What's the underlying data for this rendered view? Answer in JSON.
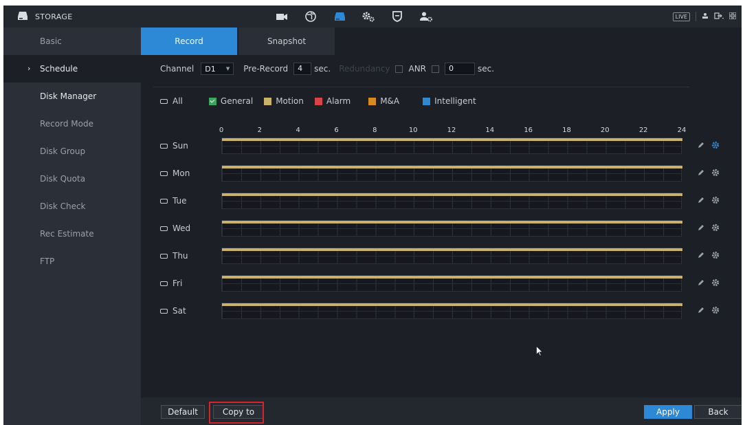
{
  "header": {
    "title": "STORAGE",
    "title_icon": "storage-drive-icon",
    "nav_icons": [
      "camera-icon",
      "network-globe-icon",
      "storage-drive-icon",
      "system-gears-icon",
      "security-shield-icon",
      "account-user-icon"
    ],
    "active_nav": "storage-drive-icon",
    "live_label": "LIVE",
    "right_icons": [
      "user-icon",
      "logout-icon",
      "grid-menu-icon"
    ]
  },
  "sidebar": {
    "items": [
      {
        "label": "Basic"
      },
      {
        "label": "Schedule",
        "arrow": "›"
      },
      {
        "label": "Disk Manager"
      },
      {
        "label": "Record Mode"
      },
      {
        "label": "Disk Group"
      },
      {
        "label": "Disk Quota"
      },
      {
        "label": "Disk Check"
      },
      {
        "label": "Rec Estimate"
      },
      {
        "label": "FTP"
      }
    ],
    "active_item": "Schedule"
  },
  "tabs": [
    {
      "label": "Record",
      "active": true
    },
    {
      "label": "Snapshot",
      "active": false
    }
  ],
  "filters": {
    "channel_label": "Channel",
    "channel_value": "D1",
    "prerecord_label": "Pre-Record",
    "prerecord_value": "4",
    "prerecord_unit": "sec.",
    "redundancy_label": "Redundancy",
    "anr_label": "ANR",
    "anr_value": "0",
    "anr_unit": "sec."
  },
  "legend": {
    "all_label": "All",
    "items": [
      {
        "label": "General",
        "color": "#3aa55c",
        "checked": true
      },
      {
        "label": "Motion",
        "color": "#c9b36a"
      },
      {
        "label": "Alarm",
        "color": "#d64545"
      },
      {
        "label": "M&A",
        "color": "#d98a1e"
      },
      {
        "label": "Intelligent",
        "color": "#2d88d6"
      }
    ]
  },
  "schedule": {
    "hours": [
      "0",
      "2",
      "4",
      "6",
      "8",
      "10",
      "12",
      "14",
      "16",
      "18",
      "20",
      "22",
      "24"
    ],
    "days": [
      {
        "label": "Sun",
        "start": 0,
        "end": 24
      },
      {
        "label": "Mon",
        "start": 0,
        "end": 24
      },
      {
        "label": "Tue",
        "start": 0,
        "end": 24
      },
      {
        "label": "Wed",
        "start": 0,
        "end": 24
      },
      {
        "label": "Thu",
        "start": 0,
        "end": 24
      },
      {
        "label": "Fri",
        "start": 0,
        "end": 24
      },
      {
        "label": "Sat",
        "start": 0,
        "end": 24
      }
    ],
    "bar_color": "#c9b36a",
    "first_gear_color": "#2d88d6"
  },
  "footer": {
    "default_label": "Default",
    "copy_label": "Copy to",
    "apply_label": "Apply",
    "back_label": "Back",
    "highlight_color": "#d6252a"
  }
}
